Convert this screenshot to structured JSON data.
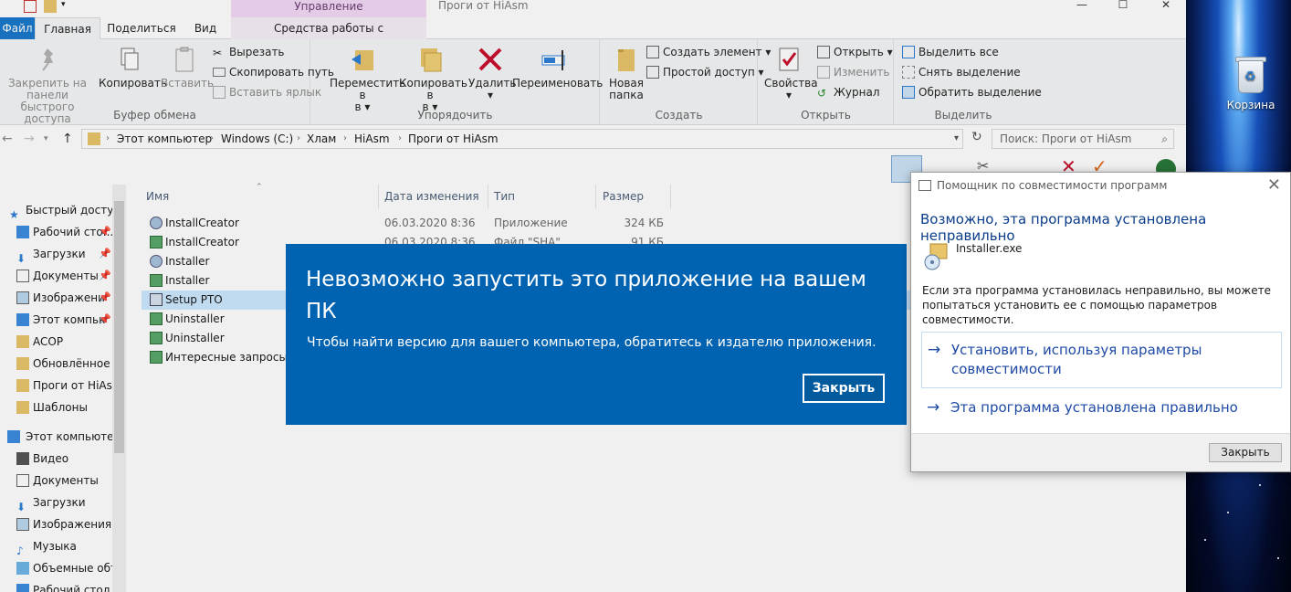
{
  "window": {
    "title": "Проги от HiAsm",
    "contextual_group": "Управление"
  },
  "tabs": [
    {
      "label": "Файл"
    },
    {
      "label": "Главная"
    },
    {
      "label": "Поделиться"
    },
    {
      "label": "Вид"
    },
    {
      "label": "Средства работы с приложениями"
    }
  ],
  "ribbon": {
    "clipboard": {
      "label": "Буфер обмена",
      "pin": "Закрепить на панели быстрого доступа",
      "copy": "Копировать",
      "paste": "Вставить",
      "cut": "Вырезать",
      "copy_path": "Скопировать путь",
      "paste_shortcut": "Вставить ярлык"
    },
    "organize": {
      "label": "Упорядочить",
      "move": "Переместить в",
      "copy_to": "Копировать в",
      "delete": "Удалить",
      "rename": "Переименовать"
    },
    "create": {
      "label": "Создать",
      "new_folder": "Новая папка",
      "new_item": "Создать элемент",
      "easy_access": "Простой доступ"
    },
    "open": {
      "label": "Открыть",
      "properties": "Свойства",
      "open": "Открыть",
      "edit": "Изменить",
      "history": "Журнал"
    },
    "select": {
      "label": "Выделить",
      "select_all": "Выделить все",
      "select_none": "Снять выделение",
      "invert": "Обратить выделение"
    }
  },
  "address": {
    "crumbs": [
      "Этот компьютер",
      "Windows (C:)",
      "Хлам",
      "HiAsm",
      "Проги от HiAsm"
    ],
    "search_placeholder": "Поиск: Проги от HiAsm"
  },
  "nav": [
    {
      "label": "Быстрый доступ",
      "icon": "star-icon",
      "level": 0
    },
    {
      "label": "Рабочий сто...",
      "icon": "desktop-icon",
      "level": 1,
      "pinned": true
    },
    {
      "label": "Загрузки",
      "icon": "download-icon",
      "level": 1,
      "pinned": true
    },
    {
      "label": "Документы",
      "icon": "document-icon",
      "level": 1,
      "pinned": true
    },
    {
      "label": "Изображени",
      "icon": "pictures-icon",
      "level": 1,
      "pinned": true
    },
    {
      "label": "Этот компьк",
      "icon": "computer-icon",
      "level": 1,
      "pinned": true
    },
    {
      "label": "ACOP",
      "icon": "folder-icon",
      "level": 1
    },
    {
      "label": "Обновлённое Г",
      "icon": "folder-icon",
      "level": 1
    },
    {
      "label": "Проги от HiAsm",
      "icon": "folder-icon",
      "level": 1
    },
    {
      "label": "Шаблоны",
      "icon": "folder-icon",
      "level": 1
    },
    {
      "label": "Этот компьютер",
      "icon": "computer-icon",
      "level": 0
    },
    {
      "label": "Видео",
      "icon": "video-icon",
      "level": 1
    },
    {
      "label": "Документы",
      "icon": "document-icon",
      "level": 1
    },
    {
      "label": "Загрузки",
      "icon": "download-icon",
      "level": 1
    },
    {
      "label": "Изображения",
      "icon": "pictures-icon",
      "level": 1
    },
    {
      "label": "Музыка",
      "icon": "music-icon",
      "level": 1
    },
    {
      "label": "Объемные объ",
      "icon": "3d-objects-icon",
      "level": 1
    },
    {
      "label": "Рабочий стол",
      "icon": "desktop-icon",
      "level": 1
    }
  ],
  "columns": {
    "name": "Имя",
    "date": "Дата изменения",
    "type": "Тип",
    "size": "Размер"
  },
  "files": [
    {
      "name": "InstallCreator",
      "date": "06.03.2020 8:36",
      "type": "Приложение",
      "size": "324 КБ",
      "icon": "installer-icon"
    },
    {
      "name": "InstallCreator",
      "date": "06.03.2020 8:36",
      "type": "Файл \"SHA\"",
      "size": "91 КБ",
      "icon": "script-icon"
    },
    {
      "name": "Installer",
      "date": "",
      "type": "",
      "size": "",
      "icon": "installer-icon"
    },
    {
      "name": "Installer",
      "date": "",
      "type": "",
      "size": "",
      "icon": "script-icon"
    },
    {
      "name": "Setup PTO",
      "date": "",
      "type": "",
      "size": "",
      "icon": "setup-icon",
      "selected": true
    },
    {
      "name": "Uninstaller",
      "date": "",
      "type": "",
      "size": "",
      "icon": "script-icon"
    },
    {
      "name": "Uninstaller",
      "date": "",
      "type": "",
      "size": "",
      "icon": "script-icon"
    },
    {
      "name": "Интересные запросы в G",
      "date": "",
      "type": "",
      "size": "",
      "icon": "script-icon"
    }
  ],
  "error_dialog": {
    "title": "Невозможно запустить это приложение на вашем ПК",
    "message": "Чтобы найти версию для вашего компьютера, обратитесь к издателю приложения.",
    "close": "Закрыть",
    "bg_color": "#0063b1"
  },
  "compat_dialog": {
    "title": "Помощник по совместимости программ",
    "heading": "Возможно, эта программа установлена неправильно",
    "app_name": "Installer.exe",
    "description": "Если эта программа установилась неправильно, вы можете попытаться установить ее с помощью параметров совместимости.",
    "option1": "Установить, используя параметры совместимости",
    "option2": "Эта программа установлена правильно",
    "close": "Закрыть"
  },
  "desktop": {
    "recycle_bin": "Корзина"
  }
}
